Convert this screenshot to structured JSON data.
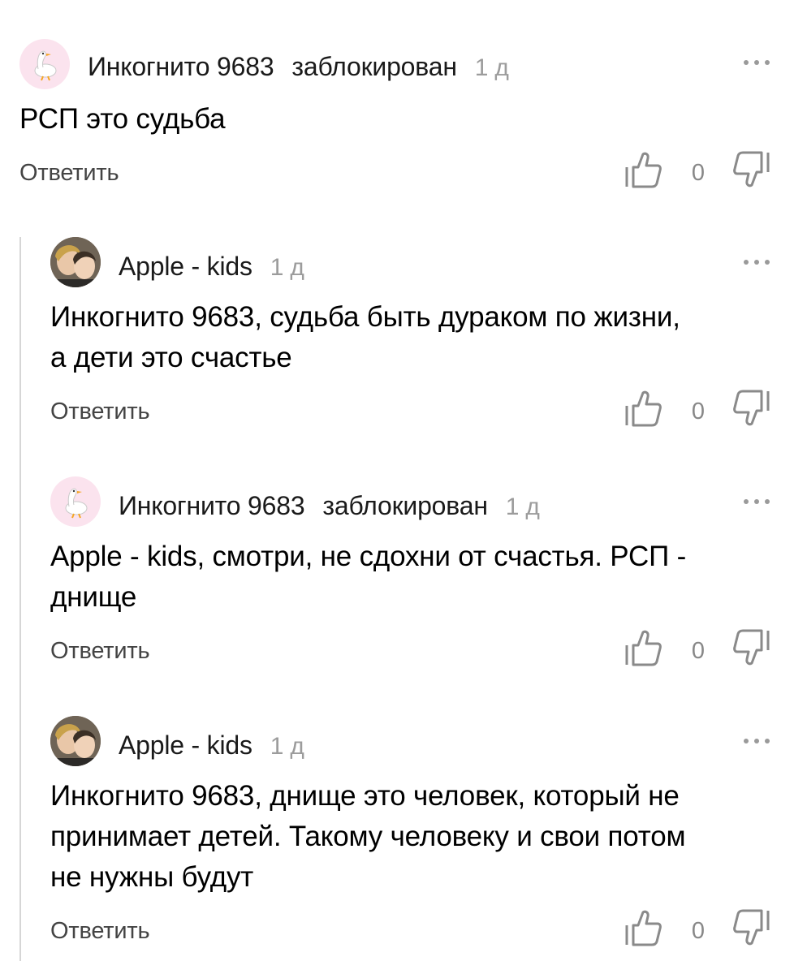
{
  "comments": [
    {
      "author": "Инкогнито 9683",
      "blocked": "заблокирован",
      "time": "1 д",
      "text_lines": [
        "РСП это судьба"
      ],
      "reply_label": "Ответить",
      "likes": "0",
      "avatar_icon": "goose-icon"
    },
    {
      "author": "Apple - kids",
      "time": "1 д",
      "text_lines": [
        "Инкогнито 9683, судьба быть дураком по жизни,",
        "а дети это счастье"
      ],
      "reply_label": "Ответить",
      "likes": "0",
      "avatar_icon": "user-photo"
    },
    {
      "author": "Инкогнито 9683",
      "blocked": "заблокирован",
      "time": "1 д",
      "text_lines": [
        "Apple - kids, смотри, не сдохни от счастья. РСП -",
        "днище"
      ],
      "reply_label": "Ответить",
      "likes": "0",
      "avatar_icon": "goose-icon"
    },
    {
      "author": "Apple - kids",
      "time": "1 д",
      "text_lines": [
        "Инкогнито 9683, днище это человек, который не",
        "принимает детей. Такому человеку и свои потом",
        "не нужны будут"
      ],
      "reply_label": "Ответить",
      "likes": "0",
      "avatar_icon": "user-photo"
    }
  ],
  "colors": {
    "muted": "#9c9c9c",
    "thread_line": "#d6d6d6",
    "goose_bg": "#fbe3ee"
  }
}
